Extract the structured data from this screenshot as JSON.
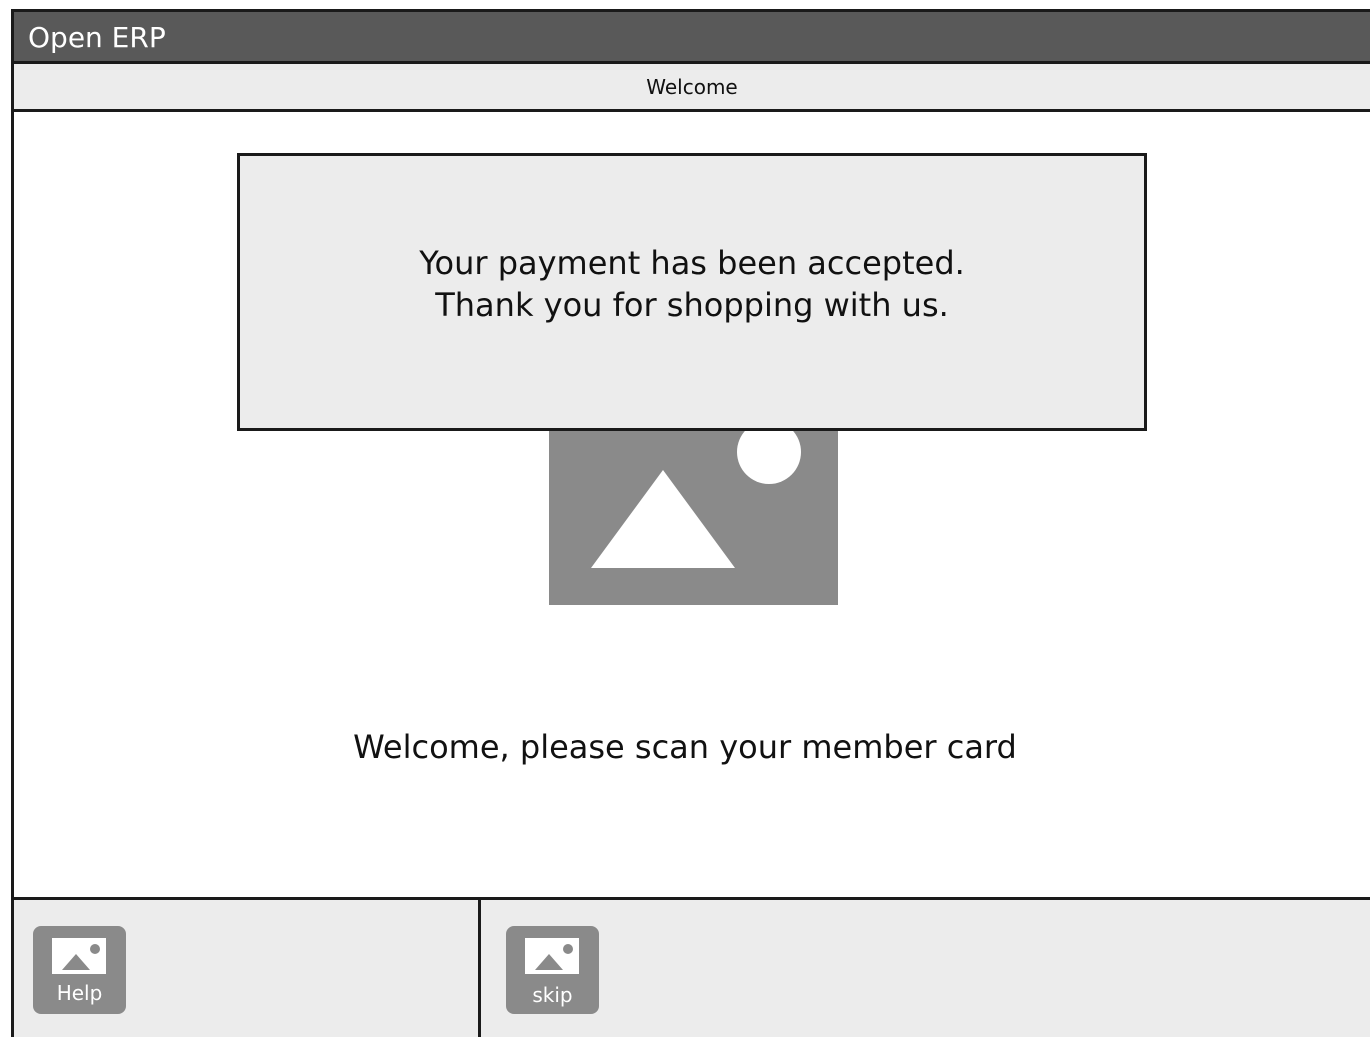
{
  "window": {
    "title": "Open ERP"
  },
  "tabs": {
    "active_label": "Welcome"
  },
  "message": {
    "line1": "Your payment has been accepted.",
    "line2": "Thank you for shopping with us."
  },
  "main": {
    "image_icon": "image-placeholder-icon",
    "scan_prompt": "Welcome, please scan your member card"
  },
  "bottom_bar": {
    "help_label": "Help",
    "help_icon": "image-icon",
    "skip_label": "skip",
    "skip_icon": "image-icon"
  },
  "colors": {
    "titlebar": "#595959",
    "panel": "#ececec",
    "placeholder": "#8a8a8a",
    "border": "#1a1a1a"
  }
}
